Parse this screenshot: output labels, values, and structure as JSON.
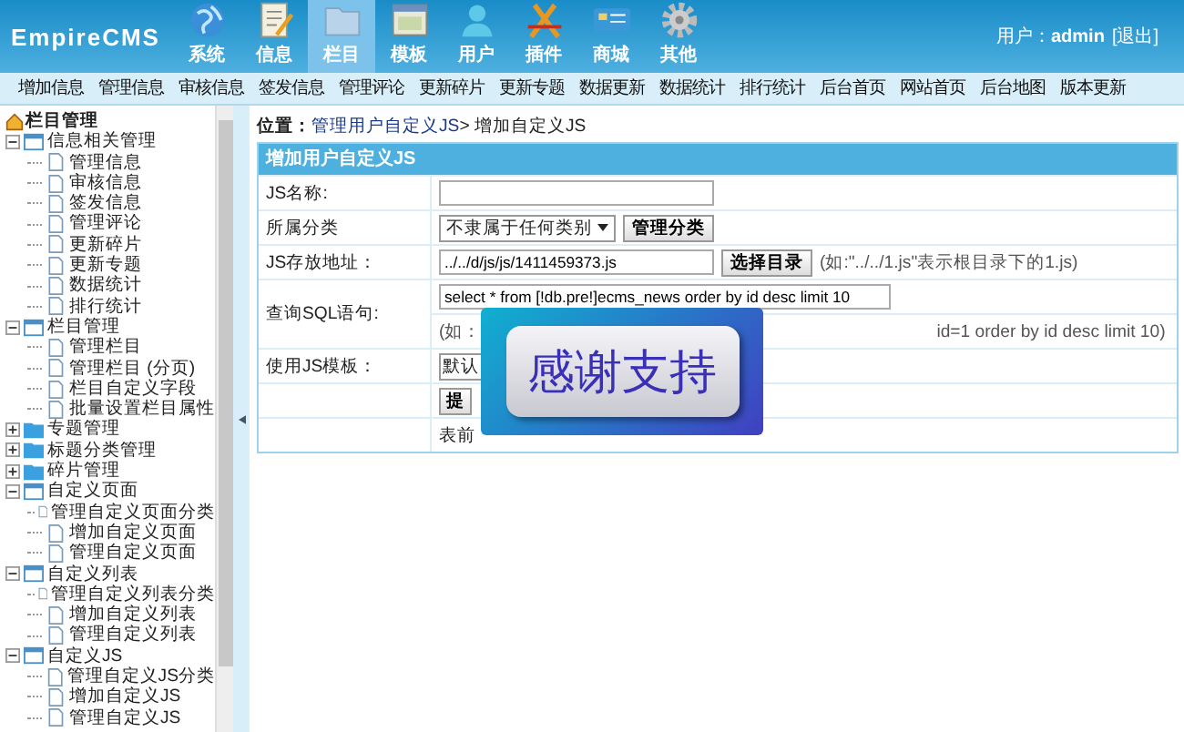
{
  "header": {
    "logo": "EmpireCMS",
    "tabs": [
      {
        "label": "系统",
        "selected": false
      },
      {
        "label": "信息",
        "selected": false
      },
      {
        "label": "栏目",
        "selected": true
      },
      {
        "label": "模板",
        "selected": false
      },
      {
        "label": "用户",
        "selected": false
      },
      {
        "label": "插件",
        "selected": false
      },
      {
        "label": "商城",
        "selected": false
      },
      {
        "label": "其他",
        "selected": false
      }
    ],
    "user_label": "用户：",
    "user_name": "admin",
    "logout": "[退出]"
  },
  "menu": [
    "增加信息",
    "管理信息",
    "审核信息",
    "签发信息",
    "管理评论",
    "更新碎片",
    "更新专题",
    "数据更新",
    "数据统计",
    "排行统计",
    "后台首页",
    "网站首页",
    "后台地图",
    "版本更新"
  ],
  "sidebar": {
    "title": "栏目管理",
    "tree": [
      {
        "label": "信息相关管理",
        "expanded": true,
        "children": [
          {
            "label": "管理信息"
          },
          {
            "label": "审核信息"
          },
          {
            "label": "签发信息"
          },
          {
            "label": "管理评论"
          },
          {
            "label": "更新碎片"
          },
          {
            "label": "更新专题"
          },
          {
            "label": "数据统计"
          },
          {
            "label": "排行统计"
          }
        ]
      },
      {
        "label": "栏目管理",
        "expanded": true,
        "children": [
          {
            "label": "管理栏目"
          },
          {
            "label": "管理栏目 (分页)"
          },
          {
            "label": "栏目自定义字段"
          },
          {
            "label": "批量设置栏目属性"
          }
        ]
      },
      {
        "label": "专题管理",
        "expanded": false
      },
      {
        "label": "标题分类管理",
        "expanded": false
      },
      {
        "label": "碎片管理",
        "expanded": false
      },
      {
        "label": "自定义页面",
        "expanded": true,
        "children": [
          {
            "label": "管理自定义页面分类"
          },
          {
            "label": "增加自定义页面"
          },
          {
            "label": "管理自定义页面"
          }
        ]
      },
      {
        "label": "自定义列表",
        "expanded": true,
        "children": [
          {
            "label": "管理自定义列表分类"
          },
          {
            "label": "增加自定义列表"
          },
          {
            "label": "管理自定义列表"
          }
        ]
      },
      {
        "label": "自定义JS",
        "expanded": true,
        "children": [
          {
            "label": "管理自定义JS分类"
          },
          {
            "label": "增加自定义JS"
          },
          {
            "label": "管理自定义JS"
          }
        ]
      }
    ]
  },
  "breadcrumb": {
    "prefix": "位置：",
    "link": "管理用户自定义JS",
    "current": "> 增加自定义JS"
  },
  "form": {
    "title": "增加用户自定义JS",
    "name_label": "JS名称:",
    "category_label": "所属分类",
    "category_value": "不隶属于任何类别",
    "category_button": "管理分类",
    "path_label": "JS存放地址：",
    "path_value": "../../d/js/js/1411459373.js",
    "path_button": "选择目录",
    "path_hint": "(如:\"../../1.js\"表示根目录下的1.js)",
    "sql_label": "查询SQL语句:",
    "sql_value": "select * from [!db.pre!]ecms_news order by id desc limit 10",
    "sql_hint_start": "(如：",
    "sql_hint_end": "id=1 order by id desc limit 10)",
    "template_label": "使用JS模板：",
    "template_value": "默认",
    "submit": "提",
    "footer": "表前"
  },
  "overlay": {
    "text": "感谢支持"
  }
}
